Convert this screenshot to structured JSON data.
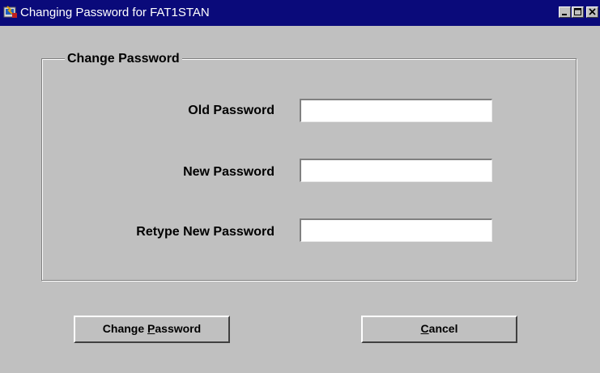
{
  "window": {
    "title": "Changing Password for FAT1STAN",
    "controls": [
      "minimize-icon",
      "maximize-icon",
      "close-icon"
    ]
  },
  "group": {
    "title": "Change Password"
  },
  "fields": [
    {
      "label": "Old Password",
      "value": ""
    },
    {
      "label": "New Password",
      "value": ""
    },
    {
      "label": "Retype New Password",
      "value": ""
    }
  ],
  "buttons": {
    "change_password": {
      "label": "Change Password",
      "mnemonic": "P"
    },
    "cancel": {
      "label": "Cancel",
      "mnemonic": "C"
    }
  },
  "colors": {
    "titlebar": "#0a0a7a",
    "window_bg": "#c0c0c0",
    "input_bg": "#ffffff"
  }
}
